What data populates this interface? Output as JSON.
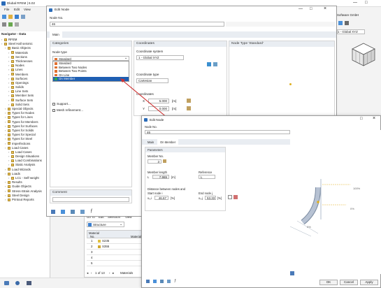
{
  "main_window": {
    "title": "Dlubal RFEM | 6.02",
    "menu": [
      "File",
      "Edit",
      "View"
    ],
    "navigator_title": "Navigator - Data",
    "tree": [
      {
        "label": "RFEM",
        "depth": 0
      },
      {
        "label": "Steel Hall seismic",
        "depth": 0
      },
      {
        "label": "Basic Objects",
        "depth": 1
      },
      {
        "label": "Materials",
        "depth": 2
      },
      {
        "label": "Sections",
        "depth": 2
      },
      {
        "label": "Thicknesses",
        "depth": 2
      },
      {
        "label": "Nodes",
        "depth": 2
      },
      {
        "label": "Lines",
        "depth": 2
      },
      {
        "label": "Members",
        "depth": 2
      },
      {
        "label": "Surfaces",
        "depth": 2
      },
      {
        "label": "Openings",
        "depth": 2
      },
      {
        "label": "Solids",
        "depth": 2
      },
      {
        "label": "Line Sets",
        "depth": 2
      },
      {
        "label": "Member Sets",
        "depth": 2
      },
      {
        "label": "Surface Sets",
        "depth": 2
      },
      {
        "label": "Solid Sets",
        "depth": 2
      },
      {
        "label": "Special Objects",
        "depth": 1
      },
      {
        "label": "Types for Nodes",
        "depth": 1
      },
      {
        "label": "Types for Lines",
        "depth": 1
      },
      {
        "label": "Types for Members",
        "depth": 1
      },
      {
        "label": "Types for Surfaces",
        "depth": 1
      },
      {
        "label": "Types for Solids",
        "depth": 1
      },
      {
        "label": "Types for Special",
        "depth": 1
      },
      {
        "label": "Types for Steel",
        "depth": 1
      },
      {
        "label": "Imperfections",
        "depth": 1
      },
      {
        "label": "Load Cases",
        "depth": 1
      },
      {
        "label": "Load Cases",
        "depth": 2
      },
      {
        "label": "Design Situations",
        "depth": 2
      },
      {
        "label": "Load Combinations",
        "depth": 2
      },
      {
        "label": "Static Analysis",
        "depth": 2
      },
      {
        "label": "Load Wizards",
        "depth": 1
      },
      {
        "label": "Loads",
        "depth": 1
      },
      {
        "label": "LC1 - Self-weight",
        "depth": 2
      },
      {
        "label": "Results",
        "depth": 1
      },
      {
        "label": "Guide Objects",
        "depth": 1
      },
      {
        "label": "Stress-Strain Analysis",
        "depth": 1
      },
      {
        "label": "Steel Design",
        "depth": 1
      },
      {
        "label": "Printout Reports",
        "depth": 1
      }
    ],
    "right_menu_text": "Software GmbH",
    "coord_combo": "1 - Global XYZ",
    "table_panel": {
      "menu": [
        "Go To",
        "Edit",
        "Selection",
        "View"
      ],
      "structure_label": "Structure",
      "col_material": "Material",
      "col_no": "No.",
      "col_material2": "Material",
      "rows": [
        {
          "no": "1",
          "name": "S235"
        },
        {
          "no": "2",
          "name": "S355"
        },
        {
          "no": "3",
          "name": ""
        },
        {
          "no": "4",
          "name": ""
        },
        {
          "no": "5",
          "name": ""
        }
      ],
      "pager": "1 of 13",
      "sheet_tab": "Materials"
    }
  },
  "edit_node_1": {
    "title": "Edit Node",
    "node_no_label": "Node No.",
    "node_no": "46",
    "tab_main": "Main",
    "categories_label": "Categories",
    "node_type_label": "Node type",
    "node_type_value": "Standard",
    "dropdown_items": [
      {
        "label": "Standard",
        "color": "#e07030"
      },
      {
        "label": "Between Two Nodes",
        "color": "#e07030"
      },
      {
        "label": "Between Two Points",
        "color": "#e07030"
      },
      {
        "label": "On Line",
        "color": "#e07030"
      },
      {
        "label": "On Member",
        "color": "#2ea84a"
      }
    ],
    "checkbox_support": "Support...",
    "checkbox_mesh": "Mesh refinement...",
    "comment_label": "Comment",
    "coordinates_label": "Coordinates",
    "coord_system_label": "Coordinate system",
    "coord_system_value": "1 - Global XYZ",
    "coord_type_label": "Coordinate type",
    "coord_type_value": "Cartesian",
    "coords_label": "Coordinates",
    "x_label": "X",
    "x_value": "5.000",
    "x_unit": "[m]",
    "y_label": "Y",
    "y_value": "0.000",
    "y_unit": "[m]",
    "node_type_header": "Node Type 'Standard'"
  },
  "edit_node_2": {
    "title": "Edit Node",
    "node_no_label": "Node No.",
    "node_no": "46",
    "tab_main": "Main",
    "tab_on_member": "On Member",
    "parameters_label": "Parameters",
    "member_no_label": "Member No.",
    "member_no": "3",
    "member_length_label": "Member length",
    "member_length_sym": "L",
    "member_length_value": "7.965",
    "member_length_unit": "[m]",
    "reference_label": "Reference",
    "reference_value": "L",
    "distance_label": "Distance between nodes and",
    "start_node_label": "Start node i",
    "start_sym": "x₀,i",
    "start_value": "46.67",
    "start_unit": "[%]",
    "end_node_label": "End node j",
    "end_sym": "x₀,j",
    "end_value": "53.33",
    "end_unit": "[%]",
    "ok_label": "OK",
    "cancel_label": "Cancel",
    "apply_label": "Apply",
    "label_100": "100%",
    "label_0": "0%",
    "label_pct": "0%",
    "min_label": "—",
    "max_label": "□",
    "close_label": "×"
  },
  "colors": {
    "selection": "#1e5fb3",
    "window_bg": "#ffffff",
    "section_bg": "#e9edf2",
    "arrow": "#d03030"
  }
}
